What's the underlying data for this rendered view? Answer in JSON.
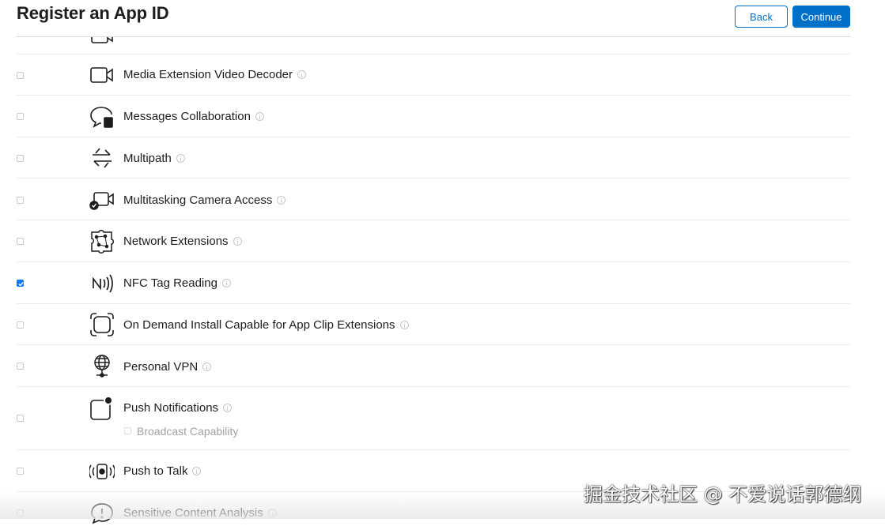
{
  "header": {
    "title": "Register an App ID",
    "back_label": "Back",
    "continue_label": "Continue"
  },
  "colors": {
    "accent": "#0070c9",
    "checkbox_checked": "#0a7aff",
    "divider": "#ececee"
  },
  "capabilities": [
    {
      "label": "",
      "icon": "camera-icon",
      "checked": false
    },
    {
      "label": "Media Extension Video Decoder",
      "icon": "video-camera-icon",
      "checked": false
    },
    {
      "label": "Messages Collaboration",
      "icon": "message-bubble-icon",
      "checked": false
    },
    {
      "label": "Multipath",
      "icon": "arrows-exchange-icon",
      "checked": false
    },
    {
      "label": "Multitasking Camera Access",
      "icon": "camera-check-icon",
      "checked": false
    },
    {
      "label": "Network Extensions",
      "icon": "network-puzzle-icon",
      "checked": false
    },
    {
      "label": "NFC Tag Reading",
      "icon": "nfc-icon",
      "checked": true
    },
    {
      "label": "On Demand Install Capable for App Clip Extensions",
      "icon": "app-clip-icon",
      "checked": false
    },
    {
      "label": "Personal VPN",
      "icon": "globe-vpn-icon",
      "checked": false
    },
    {
      "label": "Push Notifications",
      "icon": "push-notification-icon",
      "checked": false,
      "sub_option": "Broadcast Capability"
    },
    {
      "label": "Push to Talk",
      "icon": "walkie-talkie-icon",
      "checked": false
    },
    {
      "label": "Sensitive Content Analysis",
      "icon": "alert-bubble-icon",
      "checked": false
    }
  ],
  "watermark": "掘金技术社区 @ 不爱说话郭德纲"
}
